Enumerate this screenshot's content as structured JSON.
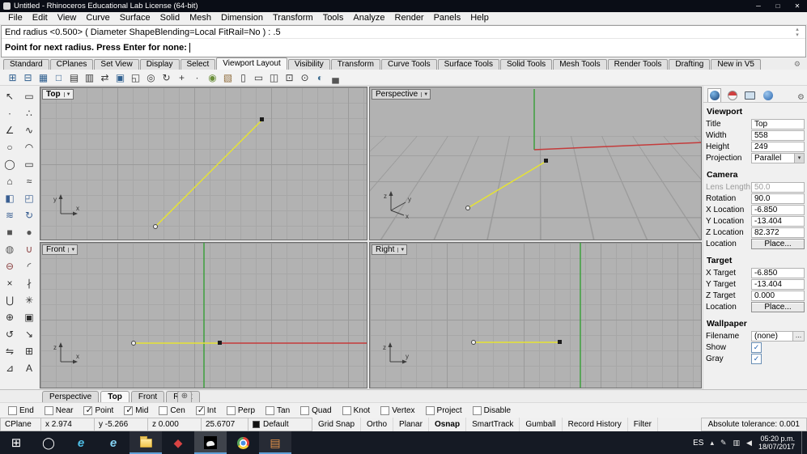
{
  "colors": {
    "curve": "#e6e332",
    "axis_red": "#c43b3b",
    "axis_green": "#3da03d"
  },
  "window": {
    "title": "Untitled - Rhinoceros Educational Lab License (64-bit)",
    "controls": [
      {
        "name": "minimize",
        "glyph": "─"
      },
      {
        "name": "maximize",
        "glyph": "□"
      },
      {
        "name": "close",
        "glyph": "✕"
      }
    ]
  },
  "menu": {
    "items": [
      {
        "name": "file",
        "label": "File"
      },
      {
        "name": "edit",
        "label": "Edit"
      },
      {
        "name": "view",
        "label": "View"
      },
      {
        "name": "curve",
        "label": "Curve"
      },
      {
        "name": "surface",
        "label": "Surface"
      },
      {
        "name": "solid",
        "label": "Solid"
      },
      {
        "name": "mesh",
        "label": "Mesh"
      },
      {
        "name": "dimension",
        "label": "Dimension"
      },
      {
        "name": "transform",
        "label": "Transform"
      },
      {
        "name": "tools",
        "label": "Tools"
      },
      {
        "name": "analyze",
        "label": "Analyze"
      },
      {
        "name": "render",
        "label": "Render"
      },
      {
        "name": "panels",
        "label": "Panels"
      },
      {
        "name": "help",
        "label": "Help"
      }
    ]
  },
  "command": {
    "history": "End radius <0.500> ( Diameter  ShapeBlending=Local  FitRail=No ) : .5",
    "prompt": "Point for next radius. Press Enter for none:"
  },
  "tab_bar": {
    "tabs": [
      {
        "name": "standard",
        "label": "Standard"
      },
      {
        "name": "cplanes",
        "label": "CPlanes"
      },
      {
        "name": "set-view",
        "label": "Set View"
      },
      {
        "name": "display",
        "label": "Display"
      },
      {
        "name": "select",
        "label": "Select"
      },
      {
        "name": "viewport-layout",
        "label": "Viewport Layout",
        "active": true
      },
      {
        "name": "visibility",
        "label": "Visibility"
      },
      {
        "name": "transform",
        "label": "Transform"
      },
      {
        "name": "curve-tools",
        "label": "Curve Tools"
      },
      {
        "name": "surface-tools",
        "label": "Surface Tools"
      },
      {
        "name": "solid-tools",
        "label": "Solid Tools"
      },
      {
        "name": "mesh-tools",
        "label": "Mesh Tools"
      },
      {
        "name": "render-tools",
        "label": "Render Tools"
      },
      {
        "name": "drafting",
        "label": "Drafting"
      },
      {
        "name": "new-in-v5",
        "label": "New in V5"
      }
    ]
  },
  "toolbar": {
    "icons": [
      {
        "name": "four-viewports",
        "glyph": "⊞",
        "color": "#2f5f8f"
      },
      {
        "name": "three-viewports",
        "glyph": "⊟",
        "color": "#2f5f8f"
      },
      {
        "name": "viewport-layout-grid",
        "glyph": "▦",
        "color": "#2f5f8f"
      },
      {
        "name": "single-viewport",
        "glyph": "□",
        "color": "#2f5f8f"
      },
      {
        "name": "split-viewport-horizontal",
        "glyph": "▤",
        "color": "#3b3b3b"
      },
      {
        "name": "split-viewport-vertical",
        "glyph": "▥",
        "color": "#3b3b3b"
      },
      {
        "name": "swap-viewports",
        "glyph": "⇄",
        "color": "#3b3b3b"
      },
      {
        "name": "maximize-viewport",
        "glyph": "▣",
        "color": "#2f5f8f"
      },
      {
        "name": "new-floating-viewport",
        "glyph": "◱",
        "color": "#3b3b3b"
      },
      {
        "name": "zoom",
        "glyph": "◎",
        "color": "#3b3b3b"
      },
      {
        "name": "rotate-view",
        "glyph": "↻",
        "color": "#3b3b3b"
      },
      {
        "name": "pan-view",
        "glyph": "+",
        "color": "#3b3b3b"
      },
      {
        "name": "target-point",
        "glyph": "∙",
        "color": "#3b3b3b"
      },
      {
        "name": "camera",
        "glyph": "◉",
        "color": "#6b8f3b"
      },
      {
        "name": "background-bitmap",
        "glyph": "▧",
        "color": "#8f6b3b"
      },
      {
        "name": "new-layout",
        "glyph": "▯",
        "color": "#3b3b3b"
      },
      {
        "name": "page-layout",
        "glyph": "▭",
        "color": "#3b3b3b"
      },
      {
        "name": "layout-details",
        "glyph": "◫",
        "color": "#3b3b3b"
      },
      {
        "name": "zoom-extents",
        "glyph": "⊡",
        "color": "#3b3b3b"
      },
      {
        "name": "zoom-selected",
        "glyph": "⊙",
        "color": "#3b3b3b"
      },
      {
        "name": "shaded-view",
        "glyph": "◐",
        "color": "#3b6b8f"
      },
      {
        "name": "print",
        "glyph": "▄",
        "color": "#555555"
      }
    ]
  },
  "palette": {
    "icons": [
      {
        "name": "select-pointer",
        "glyph": "↖",
        "color": "#2e2e2e"
      },
      {
        "name": "selection-filter",
        "glyph": "▭",
        "color": "#2e2e2e"
      },
      {
        "name": "point",
        "glyph": "∙",
        "color": "#2e2e2e"
      },
      {
        "name": "point-cloud",
        "glyph": "∴",
        "color": "#2e2e2e"
      },
      {
        "name": "polyline",
        "glyph": "∠",
        "color": "#2e2e2e"
      },
      {
        "name": "curve",
        "glyph": "∿",
        "color": "#2e2e2e"
      },
      {
        "name": "circle",
        "glyph": "○",
        "color": "#2e2e2e"
      },
      {
        "name": "arc",
        "glyph": "◠",
        "color": "#2e2e2e"
      },
      {
        "name": "ellipse",
        "glyph": "◯",
        "color": "#2e2e2e"
      },
      {
        "name": "rectangle",
        "glyph": "▭",
        "color": "#2e2e2e"
      },
      {
        "name": "polygon",
        "glyph": "⌂",
        "color": "#2e2e2e"
      },
      {
        "name": "curve-tools",
        "glyph": "≈",
        "color": "#2e2e2e"
      },
      {
        "name": "surface-plane",
        "glyph": "◧",
        "color": "#3a5f92"
      },
      {
        "name": "surface-corner",
        "glyph": "◰",
        "color": "#3a5f92"
      },
      {
        "name": "loft",
        "glyph": "≋",
        "color": "#3a5f92"
      },
      {
        "name": "revolve",
        "glyph": "↻",
        "color": "#3a5f92"
      },
      {
        "name": "box",
        "glyph": "■",
        "color": "#555555"
      },
      {
        "name": "sphere",
        "glyph": "●",
        "color": "#555555"
      },
      {
        "name": "cylinder",
        "glyph": "◍",
        "color": "#555555"
      },
      {
        "name": "boolean-union",
        "glyph": "∪",
        "color": "#8a4040"
      },
      {
        "name": "boolean-difference",
        "glyph": "⊖",
        "color": "#8a4040"
      },
      {
        "name": "fillet",
        "glyph": "◜",
        "color": "#2e2e2e"
      },
      {
        "name": "trim",
        "glyph": "×",
        "color": "#2e2e2e"
      },
      {
        "name": "split",
        "glyph": "∤",
        "color": "#2e2e2e"
      },
      {
        "name": "join",
        "glyph": "⋃",
        "color": "#2e2e2e"
      },
      {
        "name": "explode",
        "glyph": "✳",
        "color": "#2e2e2e"
      },
      {
        "name": "move",
        "glyph": "⊕",
        "color": "#2e2e2e"
      },
      {
        "name": "copy",
        "glyph": "▣",
        "color": "#2e2e2e"
      },
      {
        "name": "rotate",
        "glyph": "↺",
        "color": "#2e2e2e"
      },
      {
        "name": "scale",
        "glyph": "↘",
        "color": "#2e2e2e"
      },
      {
        "name": "mirror",
        "glyph": "⇋",
        "color": "#2e2e2e"
      },
      {
        "name": "array",
        "glyph": "⊞",
        "color": "#2e2e2e"
      },
      {
        "name": "dimension",
        "glyph": "⊿",
        "color": "#2e2e2e"
      },
      {
        "name": "text-tool",
        "glyph": "A",
        "color": "#2e2e2e"
      }
    ]
  },
  "viewports": {
    "top": {
      "name": "Top",
      "axis_v": "y",
      "axis_h": "x"
    },
    "perspective": {
      "name": "Perspective",
      "axis_v": "z",
      "axis_h": "x",
      "axis_d": "y"
    },
    "front": {
      "name": "Front",
      "axis_v": "z",
      "axis_h": "x"
    },
    "right": {
      "name": "Right",
      "axis_v": "z",
      "axis_h": "y"
    }
  },
  "panel": {
    "sections": {
      "viewport": {
        "title": "Viewport",
        "rows": [
          {
            "name": "title",
            "label": "Title",
            "value": "Top",
            "kind": "text"
          },
          {
            "name": "width",
            "label": "Width",
            "value": "558",
            "kind": "text"
          },
          {
            "name": "height",
            "label": "Height",
            "value": "249",
            "kind": "text"
          },
          {
            "name": "projection",
            "label": "Projection",
            "value": "Parallel",
            "kind": "dropdown"
          }
        ]
      },
      "camera": {
        "title": "Camera",
        "rows": [
          {
            "name": "lens-length",
            "label": "Lens Length",
            "value": "50.0",
            "kind": "text disabled"
          },
          {
            "name": "rotation",
            "label": "Rotation",
            "value": "90.0",
            "kind": "text"
          },
          {
            "name": "x-location",
            "label": "X Location",
            "value": "-6.850",
            "kind": "text"
          },
          {
            "name": "y-location",
            "label": "Y Location",
            "value": "-13.404",
            "kind": "text"
          },
          {
            "name": "z-location",
            "label": "Z Location",
            "value": "82.372",
            "kind": "text"
          },
          {
            "name": "camera-location",
            "label": "Location",
            "value": "Place...",
            "kind": "button"
          }
        ]
      },
      "target": {
        "title": "Target",
        "rows": [
          {
            "name": "x-target",
            "label": "X Target",
            "value": "-6.850",
            "kind": "text"
          },
          {
            "name": "y-target",
            "label": "Y Target",
            "value": "-13.404",
            "kind": "text"
          },
          {
            "name": "z-target",
            "label": "Z Target",
            "value": "0.000",
            "kind": "text"
          },
          {
            "name": "target-location",
            "label": "Location",
            "value": "Place...",
            "kind": "button"
          }
        ]
      },
      "wallpaper": {
        "title": "Wallpaper",
        "rows": [
          {
            "name": "filename",
            "label": "Filename",
            "value": "(none)",
            "kind": "file"
          },
          {
            "name": "show",
            "label": "Show",
            "value": "",
            "kind": "check",
            "checked": true
          },
          {
            "name": "gray",
            "label": "Gray",
            "value": "",
            "kind": "check",
            "checked": true
          }
        ]
      }
    }
  },
  "viewport_tab_bar": {
    "tabs": [
      {
        "name": "perspective",
        "label": "Perspective"
      },
      {
        "name": "top",
        "label": "Top",
        "active": true
      },
      {
        "name": "front",
        "label": "Front"
      },
      {
        "name": "right",
        "label": "Right"
      }
    ]
  },
  "osnap_bar": {
    "items": [
      {
        "name": "end",
        "label": "End"
      },
      {
        "name": "near",
        "label": "Near"
      },
      {
        "name": "point",
        "label": "Point",
        "checked": true
      },
      {
        "name": "mid",
        "label": "Mid",
        "checked": true
      },
      {
        "name": "cen",
        "label": "Cen"
      },
      {
        "name": "int",
        "label": "Int",
        "checked": true
      },
      {
        "name": "perp",
        "label": "Perp"
      },
      {
        "name": "tan",
        "label": "Tan"
      },
      {
        "name": "quad",
        "label": "Quad"
      },
      {
        "name": "knot",
        "label": "Knot"
      },
      {
        "name": "vertex",
        "label": "Vertex"
      },
      {
        "name": "project",
        "label": "Project"
      },
      {
        "name": "disable",
        "label": "Disable"
      }
    ]
  },
  "status_bar": {
    "cells": [
      {
        "name": "cplane",
        "label": "CPlane"
      },
      {
        "name": "x-coordinate",
        "label": "x 2.974"
      },
      {
        "name": "y-coordinate",
        "label": "y -5.266"
      },
      {
        "name": "z-coordinate",
        "label": "z 0.000"
      },
      {
        "name": "angle",
        "label": "25.6707"
      },
      {
        "name": "layer",
        "label": "Default",
        "swatch": true
      }
    ],
    "toggles": [
      {
        "name": "grid-snap",
        "label": "Grid Snap"
      },
      {
        "name": "ortho",
        "label": "Ortho"
      },
      {
        "name": "planar",
        "label": "Planar"
      },
      {
        "name": "osnap",
        "label": "Osnap",
        "active": true
      },
      {
        "name": "smarttrack",
        "label": "SmartTrack"
      },
      {
        "name": "gumball",
        "label": "Gumball"
      },
      {
        "name": "record-history",
        "label": "Record History"
      },
      {
        "name": "filter",
        "label": "Filter"
      }
    ],
    "tolerance": "Absolute tolerance: 0.001"
  },
  "taskbar": {
    "apps": [
      {
        "name": "start",
        "glyph": "⊞",
        "color": "#ffffff"
      },
      {
        "name": "cortana",
        "glyph": "◯",
        "color": "#ffffff"
      },
      {
        "name": "edge",
        "glyph": "e",
        "color": "#4fc0e8"
      },
      {
        "name": "internet-explorer",
        "glyph": "e",
        "color": "#85d4f5"
      },
      {
        "name": "file-explorer",
        "glyph": "",
        "open": true
      },
      {
        "name": "red-app",
        "glyph": "◆",
        "color": "#d84343"
      },
      {
        "name": "rhino",
        "glyph": "",
        "open": true,
        "active": true
      },
      {
        "name": "chrome",
        "glyph": ""
      },
      {
        "name": "document-app",
        "glyph": "▤",
        "color": "#e8944a",
        "open": true
      }
    ],
    "tray": {
      "language": "ES",
      "icons": [
        {
          "name": "hidden-icons-chevron",
          "glyph": "▴"
        },
        {
          "name": "pen-icon",
          "glyph": "✎"
        },
        {
          "name": "network-icon",
          "glyph": "▥"
        },
        {
          "name": "volume-icon",
          "glyph": "◀"
        }
      ],
      "time": "05:20 p.m.",
      "date": "18/07/2017"
    }
  }
}
